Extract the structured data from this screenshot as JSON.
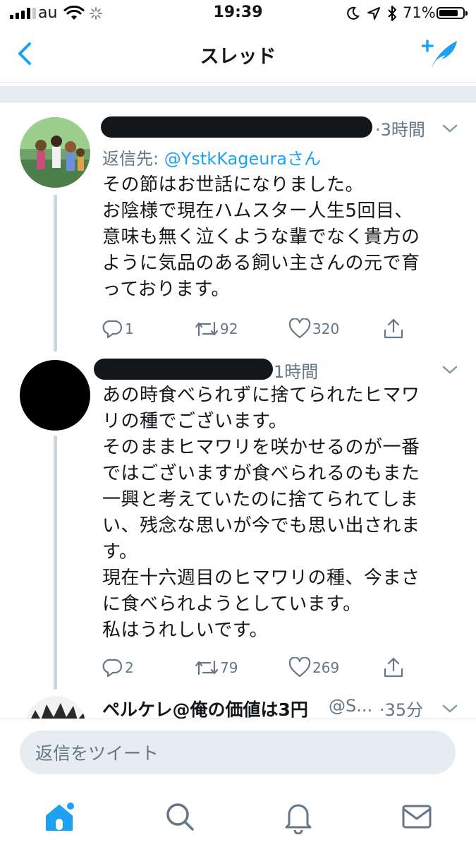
{
  "status_bar": {
    "carrier": "au",
    "time": "19:39",
    "battery_percent": "71%"
  },
  "nav": {
    "title": "スレッド"
  },
  "tweets": [
    {
      "time": "·3時間",
      "reply_to_label": "返信先: ",
      "reply_to_handle": "@YstkKageuraさん",
      "text": "その節はお世話になりました。\nお陰様で現在ハムスター人生5回目、\n意味も無く泣くような輩でなく貴方の\nように気品のある飼い主さんの元で育\nっております。",
      "replies": "1",
      "retweets": "92",
      "likes": "320"
    },
    {
      "time": "1時間",
      "text": "あの時食べられずに捨てられたヒマワ\nリの種でございます。\nそのままヒマワリを咲かせるのが一番\nではございますが食べられるのもまた\n一興と考えていたのに捨てられてしま\nい、残念な思いが今でも思い出されま\nす。\n現在十六週目のヒマワリの種、今まさ\nに食べられようとしています。\n私はうれしいです。",
      "replies": "2",
      "retweets": "79",
      "likes": "269"
    },
    {
      "name": "ペルケレ@俺の価値は3円",
      "handle": "@S...",
      "time": "·35分"
    }
  ],
  "composer": {
    "placeholder": "返信をツイート"
  },
  "tabs": [
    "home",
    "search",
    "notifications",
    "messages"
  ],
  "colors": {
    "accent": "#1da1f2",
    "muted": "#657786",
    "divider": "#e6ecf0"
  }
}
